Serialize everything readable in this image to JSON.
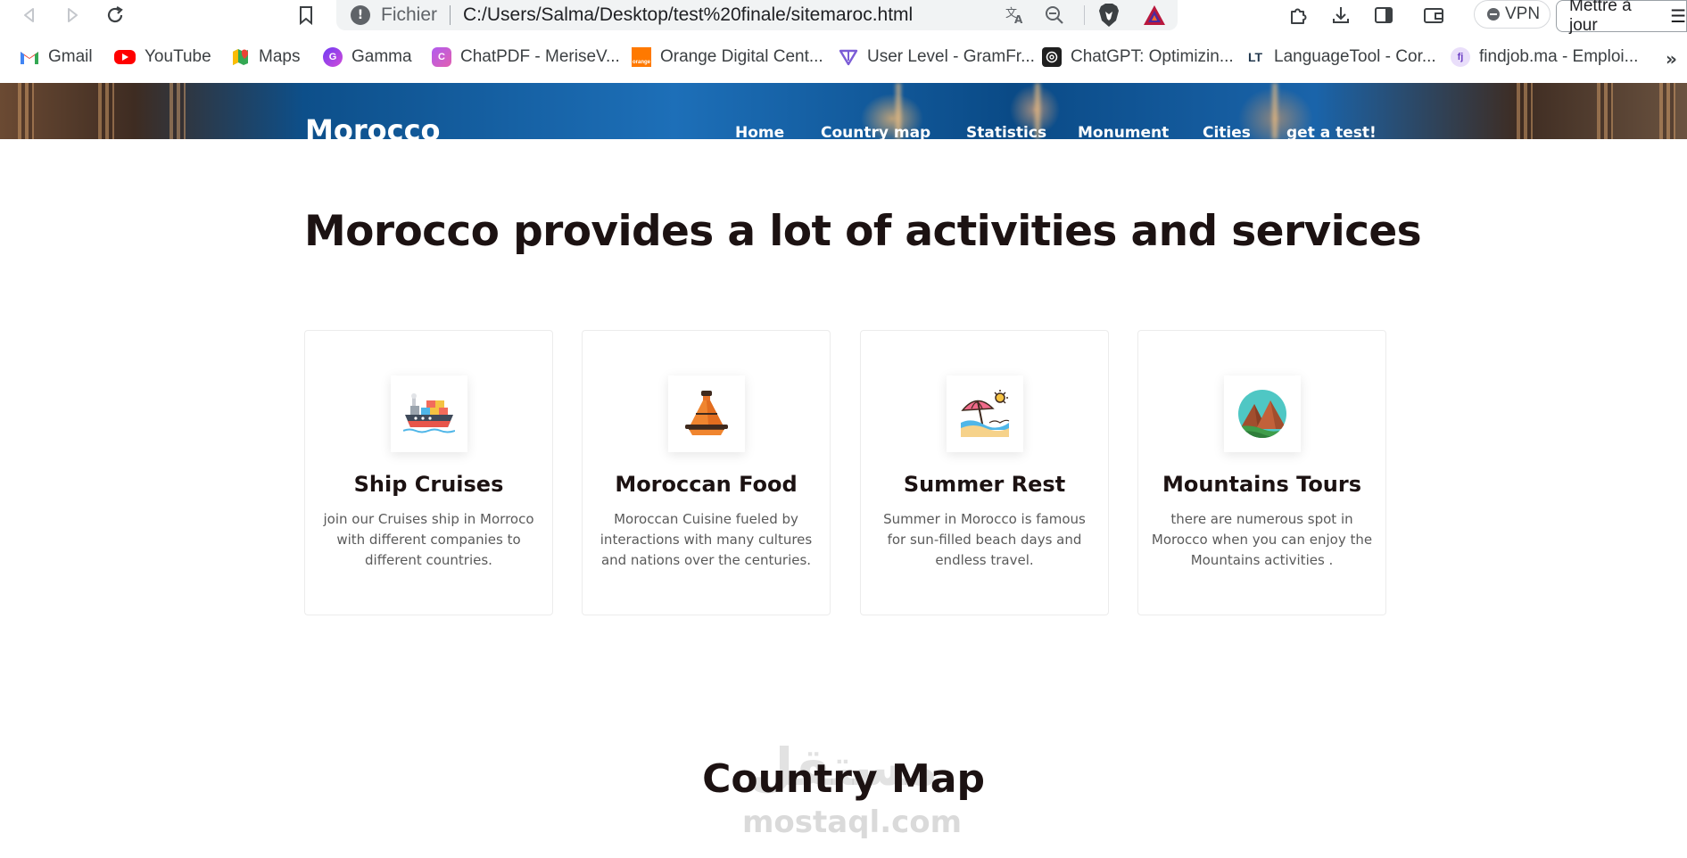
{
  "browser": {
    "address": {
      "scheme": "Fichier",
      "url": "C:/Users/Salma/Desktop/test%20finale/sitemaroc.html"
    },
    "vpn_label": "VPN",
    "update_label": "Mettre à jour",
    "bookmarks": [
      {
        "label": "Gmail",
        "icon": "gmail-icon"
      },
      {
        "label": "YouTube",
        "icon": "youtube-icon"
      },
      {
        "label": "Maps",
        "icon": "maps-icon"
      },
      {
        "label": "Gamma",
        "icon": "gamma-icon"
      },
      {
        "label": "ChatPDF - MeriseV...",
        "icon": "chatpdf-icon"
      },
      {
        "label": "Orange Digital Cent...",
        "icon": "orange-icon"
      },
      {
        "label": "User Level - GramFr...",
        "icon": "gramfree-icon"
      },
      {
        "label": "ChatGPT: Optimizin...",
        "icon": "chatgpt-icon"
      },
      {
        "label": "LanguageTool - Cor...",
        "icon": "languagetool-icon"
      },
      {
        "label": "findjob.ma - Emploi...",
        "icon": "findjob-icon"
      }
    ],
    "favicon_text": {
      "orange": "orange",
      "languagetool": "LT",
      "findjob": "fj"
    }
  },
  "site": {
    "brand": "Morocco",
    "nav": [
      "Home",
      "Country map",
      "Statistics",
      "Monument",
      "Cities",
      "get a test!"
    ]
  },
  "services": {
    "title": "Morocco provides a lot of activities and services",
    "cards": [
      {
        "title": "Ship Cruises",
        "text": "join our Cruises ship in Morroco with different companies to different countries.",
        "icon": "ship-icon"
      },
      {
        "title": "Moroccan Food",
        "text": "Moroccan Cuisine fueled by interactions with many cultures and nations over the centuries.",
        "icon": "tajine-icon"
      },
      {
        "title": "Summer Rest",
        "text": "Summer in Morocco is famous for sun-filled beach days and endless travel.",
        "icon": "beach-umbrella-icon"
      },
      {
        "title": "Mountains Tours",
        "text": "there are numerous spot in Morocco when you can enjoy the Mountains activities .",
        "icon": "mountains-icon"
      }
    ]
  },
  "country_map": {
    "title": "Country Map"
  },
  "watermark": {
    "arabic": "مستقل",
    "latin": "mostaql.com"
  }
}
